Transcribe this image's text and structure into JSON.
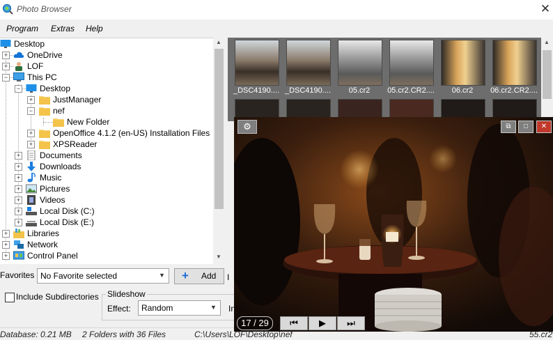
{
  "window": {
    "title": "Photo Browser",
    "close_glyph": "✕"
  },
  "menu": {
    "items": [
      "Program",
      "Extras",
      "Help"
    ]
  },
  "tree": {
    "items": [
      {
        "label": "Desktop",
        "icon": "desktop-icon"
      },
      {
        "label": "OneDrive",
        "icon": "cloud-icon"
      },
      {
        "label": "LOF",
        "icon": "user-icon"
      },
      {
        "label": "This PC",
        "icon": "computer-icon"
      },
      {
        "label": "Desktop",
        "icon": "desktop-icon"
      },
      {
        "label": "JustManager",
        "icon": "folder-icon"
      },
      {
        "label": "nef",
        "icon": "folder-icon"
      },
      {
        "label": "New Folder",
        "icon": "folder-icon"
      },
      {
        "label": "OpenOffice 4.1.2 (en-US) Installation Files",
        "icon": "folder-icon"
      },
      {
        "label": "XPSReader",
        "icon": "folder-icon"
      },
      {
        "label": "Documents",
        "icon": "documents-icon"
      },
      {
        "label": "Downloads",
        "icon": "download-icon"
      },
      {
        "label": "Music",
        "icon": "music-icon"
      },
      {
        "label": "Pictures",
        "icon": "pictures-icon"
      },
      {
        "label": "Videos",
        "icon": "videos-icon"
      },
      {
        "label": "Local Disk (C:)",
        "icon": "drive-icon"
      },
      {
        "label": "Local Disk (E:)",
        "icon": "drive-icon"
      },
      {
        "label": "Libraries",
        "icon": "libraries-icon"
      },
      {
        "label": "Network",
        "icon": "network-icon"
      },
      {
        "label": "Control Panel",
        "icon": "control-panel-icon"
      }
    ]
  },
  "thumbnails": {
    "items": [
      {
        "label": "_DSC4190...."
      },
      {
        "label": "_DSC4190...."
      },
      {
        "label": "05.cr2"
      },
      {
        "label": "05.cr2.CR2...."
      },
      {
        "label": "06.cr2"
      },
      {
        "label": "06.cr2.CR2...."
      }
    ]
  },
  "favorites": {
    "label": "Favorites",
    "selected": "No Favorite selected",
    "add_label": "Add",
    "right_label": "I"
  },
  "options": {
    "include_subdirectories": "Include Subdirectories",
    "slideshow_title": "Slideshow",
    "effect_label": "Effect:",
    "effect_value": "Random",
    "right_label": "In"
  },
  "status": {
    "database": "Database: 0.21 MB",
    "folders": "2 Folders with 36 Files",
    "path": "C:\\Users\\LOF\\Desktop\\nef",
    "extra": "55.cr2"
  },
  "viewer": {
    "counter": "17 / 29",
    "prev_glyph": "⏮",
    "play_glyph": "▶",
    "next_glyph": "⏭"
  },
  "colors": {
    "accent": "#1e6bd6",
    "thumb_background": "#6d6d6d",
    "viewer_background": "#1a0e08"
  }
}
